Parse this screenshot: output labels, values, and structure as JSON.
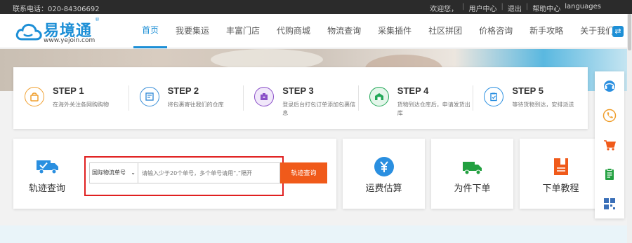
{
  "topbar": {
    "phone": "联系电话：020-84306692",
    "links": [
      "欢迎您，",
      "用户中心",
      "退出",
      "帮助中心",
      "languages"
    ]
  },
  "header": {
    "logo_text": "易境通",
    "logo_reg": "®",
    "logo_url": "www.yejoin.com",
    "nav": [
      "首页",
      "我要集运",
      "丰富门店",
      "代购商城",
      "物流查询",
      "采集插件",
      "社区拼团",
      "价格咨询",
      "新手攻略",
      "关于我们"
    ],
    "active_nav": "首页"
  },
  "steps": [
    {
      "title": "STEP 1",
      "desc": "在海外关注各网购购物",
      "icon": "shopping-bag-icon",
      "color": "#f0a030"
    },
    {
      "title": "STEP 2",
      "desc": "将包裹寄往我们的仓库",
      "icon": "form-icon",
      "color": "#3a8fd8"
    },
    {
      "title": "STEP 3",
      "desc": "登录后台打包订单添加包裹信息",
      "icon": "package-icon",
      "color": "#8a4fc8"
    },
    {
      "title": "STEP 4",
      "desc": "货物到达仓库后，申请发货出库",
      "icon": "warehouse-icon",
      "color": "#22a858"
    },
    {
      "title": "STEP 5",
      "desc": "等待货物到达，安排派送",
      "icon": "clipboard-icon",
      "color": "#2a8fe0"
    }
  ],
  "tracking": {
    "label": "轨迹查询",
    "select_value": "国际物流单号",
    "placeholder": "请输入少于20个单号，多个单号请用“,”隔开",
    "button": "轨迹查询"
  },
  "services": [
    {
      "label": "运费估算",
      "icon": "yen-icon",
      "color": "#2a8fe0"
    },
    {
      "label": "为件下单",
      "icon": "truck-icon",
      "color": "#22a040"
    },
    {
      "label": "下单教程",
      "icon": "document-icon",
      "color": "#f05a1a"
    }
  ],
  "sidebar": [
    {
      "icon": "customer-service-icon",
      "color": "#2a8fe0"
    },
    {
      "icon": "phone-icon",
      "color": "#f0a030"
    },
    {
      "icon": "cart-icon",
      "color": "#f05a1a"
    },
    {
      "icon": "notepad-icon",
      "color": "#22a040"
    },
    {
      "icon": "qrcode-icon",
      "color": "#3a6fb8"
    }
  ]
}
